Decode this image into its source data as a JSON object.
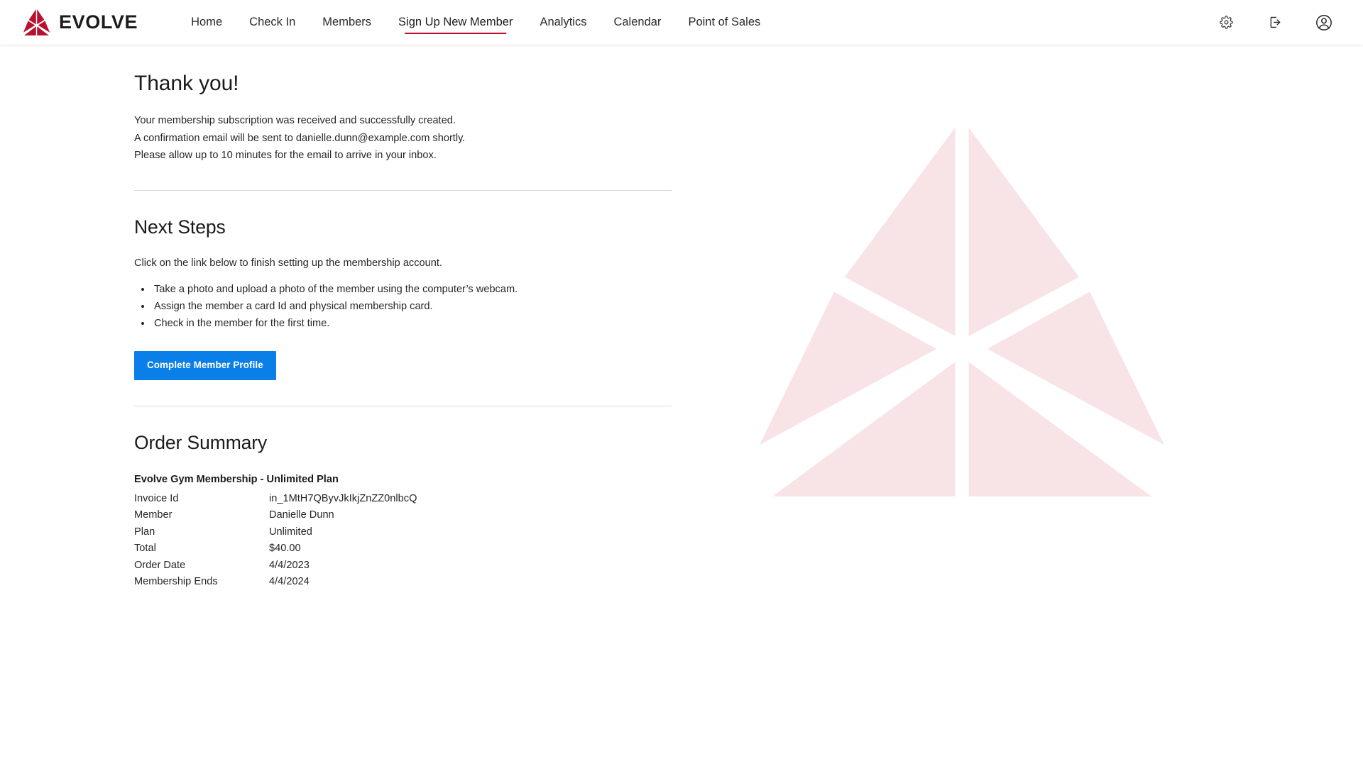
{
  "brand": {
    "name": "EVOLVE",
    "logo_icon": "evolve-triangle-logo",
    "logo_color": "#b8102f",
    "watermark_color": "#f8e3e7"
  },
  "nav": {
    "items": [
      {
        "label": "Home",
        "active": false
      },
      {
        "label": "Check In",
        "active": false
      },
      {
        "label": "Members",
        "active": false
      },
      {
        "label": "Sign Up New Member",
        "active": true
      },
      {
        "label": "Analytics",
        "active": false
      },
      {
        "label": "Calendar",
        "active": false
      },
      {
        "label": "Point of Sales",
        "active": false
      }
    ],
    "active_underline_color": "#b8102f"
  },
  "header_actions": [
    {
      "name": "settings-icon",
      "title": "Settings"
    },
    {
      "name": "logout-icon",
      "title": "Log out"
    },
    {
      "name": "account-circle-icon",
      "title": "Account"
    }
  ],
  "main": {
    "title": "Thank you!",
    "confirmation_lines": [
      "Your membership subscription was received and successfully created.",
      "A confirmation email will be sent to danielle.dunn@example.com shortly.",
      "Please allow up to 10 minutes for the email to arrive in your inbox."
    ],
    "next_steps": {
      "heading": "Next Steps",
      "lede": "Click on the link below to finish setting up the membership account.",
      "items": [
        "Take a photo and upload a photo of the member using the computer’s webcam.",
        "Assign the member a card Id and physical membership card.",
        "Check in the member for the first time."
      ],
      "cta_label": "Complete Member Profile",
      "cta_color": "#0b7fe8"
    },
    "order_summary": {
      "heading": "Order Summary",
      "product": "Evolve Gym Membership - Unlimited Plan",
      "rows": [
        {
          "label": "Invoice Id",
          "value": "in_1MtH7QByvJkIkjZnZZ0nlbcQ"
        },
        {
          "label": "Member",
          "value": "Danielle Dunn"
        },
        {
          "label": "Plan",
          "value": "Unlimited"
        },
        {
          "label": "Total",
          "value": "$40.00"
        },
        {
          "label": "Order Date",
          "value": "4/4/2023"
        },
        {
          "label": "Membership Ends",
          "value": "4/4/2024"
        }
      ]
    }
  }
}
